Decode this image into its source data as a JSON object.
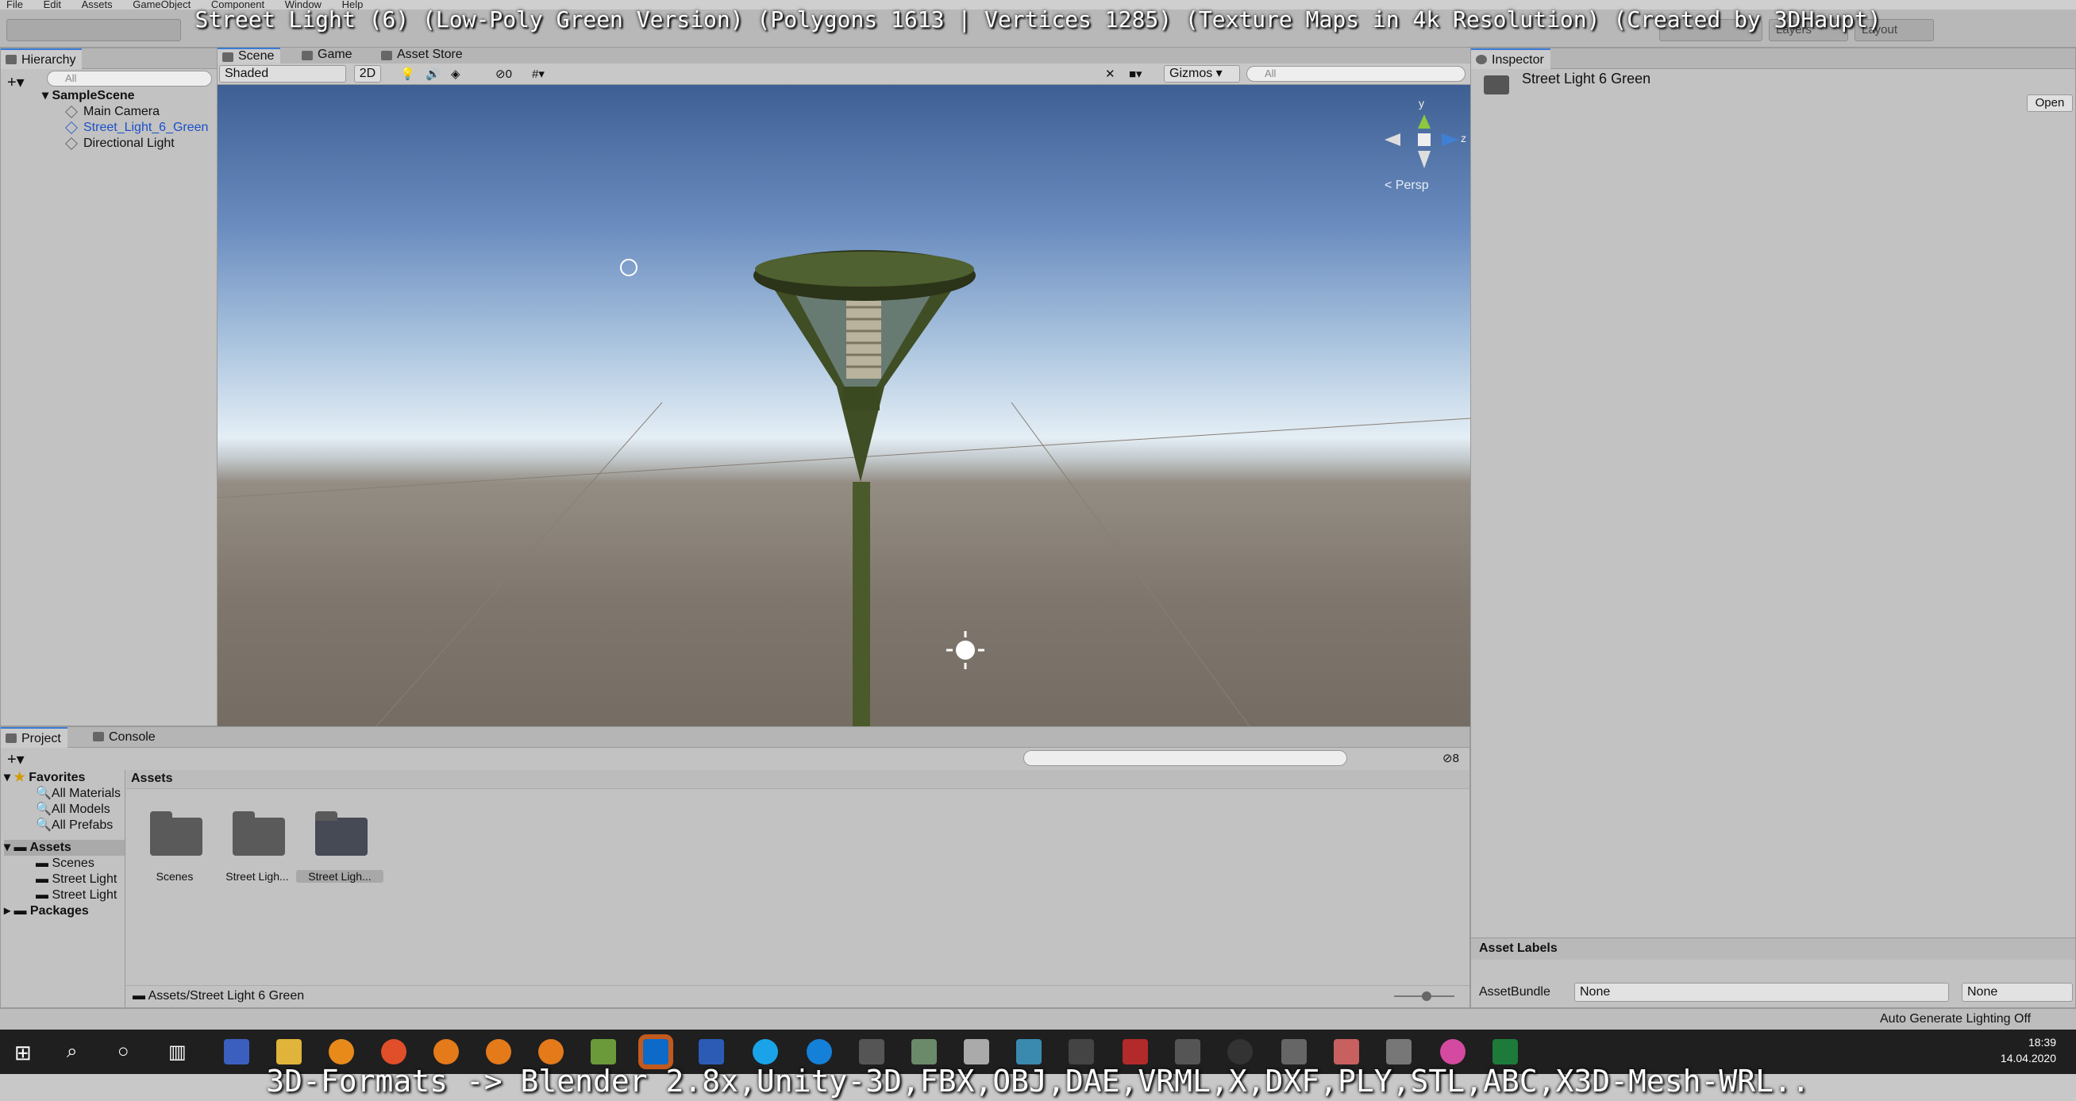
{
  "menu": [
    "File",
    "Edit",
    "Assets",
    "GameObject",
    "Component",
    "Window",
    "Help"
  ],
  "overlay_title": "Street Light (6) (Low-Poly Green Version) (Polygons 1613 | Vertices 1285) (Texture Maps in 4k Resolution) (Created by 3DHaupt)",
  "toolbar": {
    "layers": "Layers",
    "layout": "Layout"
  },
  "hierarchy": {
    "tab": "Hierarchy",
    "search_placeholder": "All",
    "scene": "SampleScene",
    "items": [
      "Main Camera",
      "Street_Light_6_Green",
      "Directional Light"
    ]
  },
  "scene_tabs": [
    "Scene",
    "Game",
    "Asset Store"
  ],
  "scene_toolbar": {
    "shading": "Shaded",
    "mode_2d": "2D",
    "hidden_count": "0",
    "gizmos": "Gizmos",
    "search_placeholder": "All"
  },
  "scene": {
    "persp": "< Persp",
    "axis_y": "y",
    "axis_z": "z"
  },
  "inspector": {
    "tab": "Inspector",
    "object_name": "Street Light 6 Green",
    "open_button": "Open",
    "asset_labels": "Asset Labels",
    "assetbundle_label": "AssetBundle",
    "bundle_value": "None",
    "variant_value": "None"
  },
  "project": {
    "tabs": [
      "Project",
      "Console"
    ],
    "favorites_header": "Favorites",
    "favorites": [
      "All Materials",
      "All Models",
      "All Prefabs"
    ],
    "assets_header": "Assets",
    "asset_tree": [
      "Scenes",
      "Street Light",
      "Street Light"
    ],
    "packages": "Packages",
    "breadcrumb": "Assets",
    "filter_count": "8",
    "items": [
      "Scenes",
      "Street Ligh...",
      "Street Ligh..."
    ],
    "path": "Assets/Street Light 6 Green"
  },
  "status": {
    "lighting": "Auto Generate Lighting Off"
  },
  "taskbar": {
    "time": "18:39",
    "date": "14.04.2020"
  },
  "subtitle": "3D-Formats -> Blender 2.8x,Unity-3D,FBX,OBJ,DAE,VRML,X,DXF,PLY,STL,ABC,X3D-Mesh-WRL.."
}
